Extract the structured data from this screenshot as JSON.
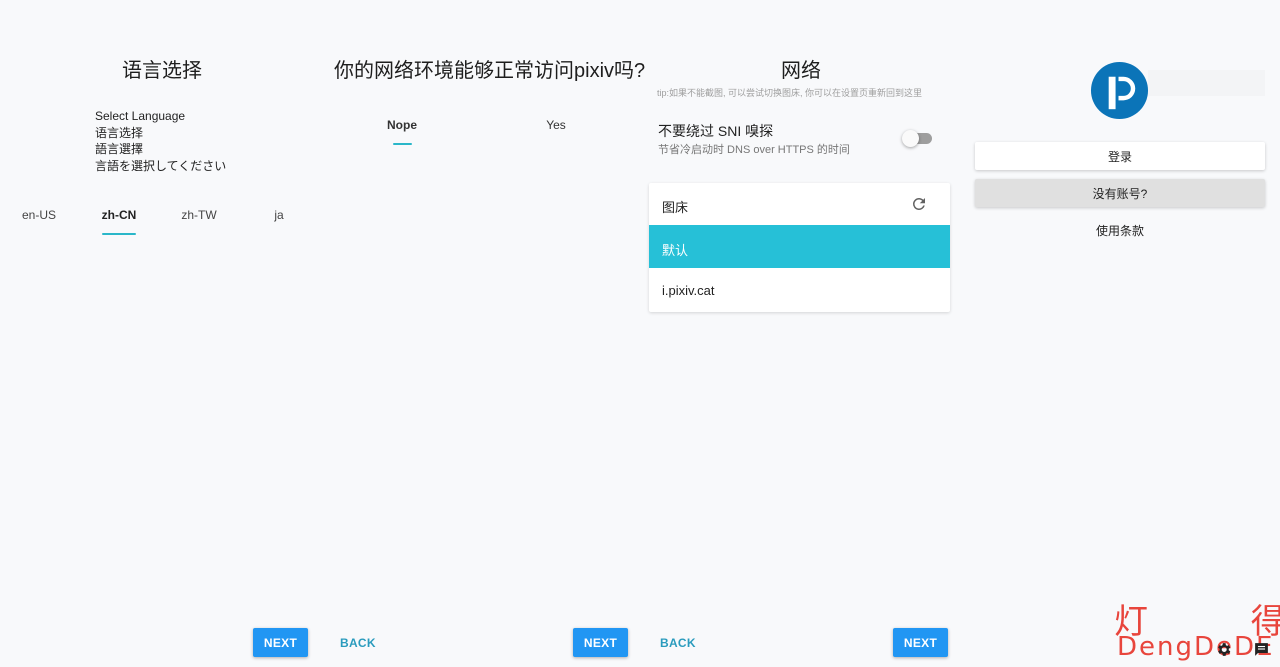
{
  "panel_language": {
    "title": "语言选择",
    "lines": [
      "Select Language",
      "语言选择",
      "語言選擇",
      "言語を選択してください"
    ],
    "tabs": [
      {
        "label": "en-US",
        "active": false
      },
      {
        "label": "zh-CN",
        "active": true
      },
      {
        "label": "zh-TW",
        "active": false
      },
      {
        "label": "ja",
        "active": false
      }
    ],
    "next_label": "NEXT"
  },
  "panel_access": {
    "title": "你的网络环境能够正常访问pixiv吗?",
    "options": [
      {
        "label": "Nope",
        "active": true
      },
      {
        "label": "Yes",
        "active": false
      }
    ],
    "back_label": "BACK",
    "next_label": "NEXT"
  },
  "panel_network": {
    "title": "网络",
    "tip": "tip:如果不能截图, 可以尝试切换图床, 你可以在设置页重新回到这里",
    "sni_title": "不要绕过 SNI 嗅探",
    "sni_subtitle": "节省冷启动时 DNS over HTTPS 的时间",
    "sni_enabled": false,
    "image_host_label": "图床",
    "hosts": [
      {
        "label": "默认",
        "selected": true
      },
      {
        "label": "i.pixiv.cat",
        "selected": false
      }
    ],
    "back_label": "BACK",
    "next_label": "NEXT"
  },
  "panel_login": {
    "login_label": "登录",
    "no_account_label": "没有账号?",
    "terms_label": "使用条款"
  },
  "watermark": {
    "cn": "灯 得",
    "en": "DengDeDE"
  },
  "colors": {
    "accent": "#2196f3",
    "teal": "#26c0d7",
    "back_text": "#2a9bbd",
    "logo_blue": "#0b74b8",
    "watermark": "#e8453c"
  }
}
